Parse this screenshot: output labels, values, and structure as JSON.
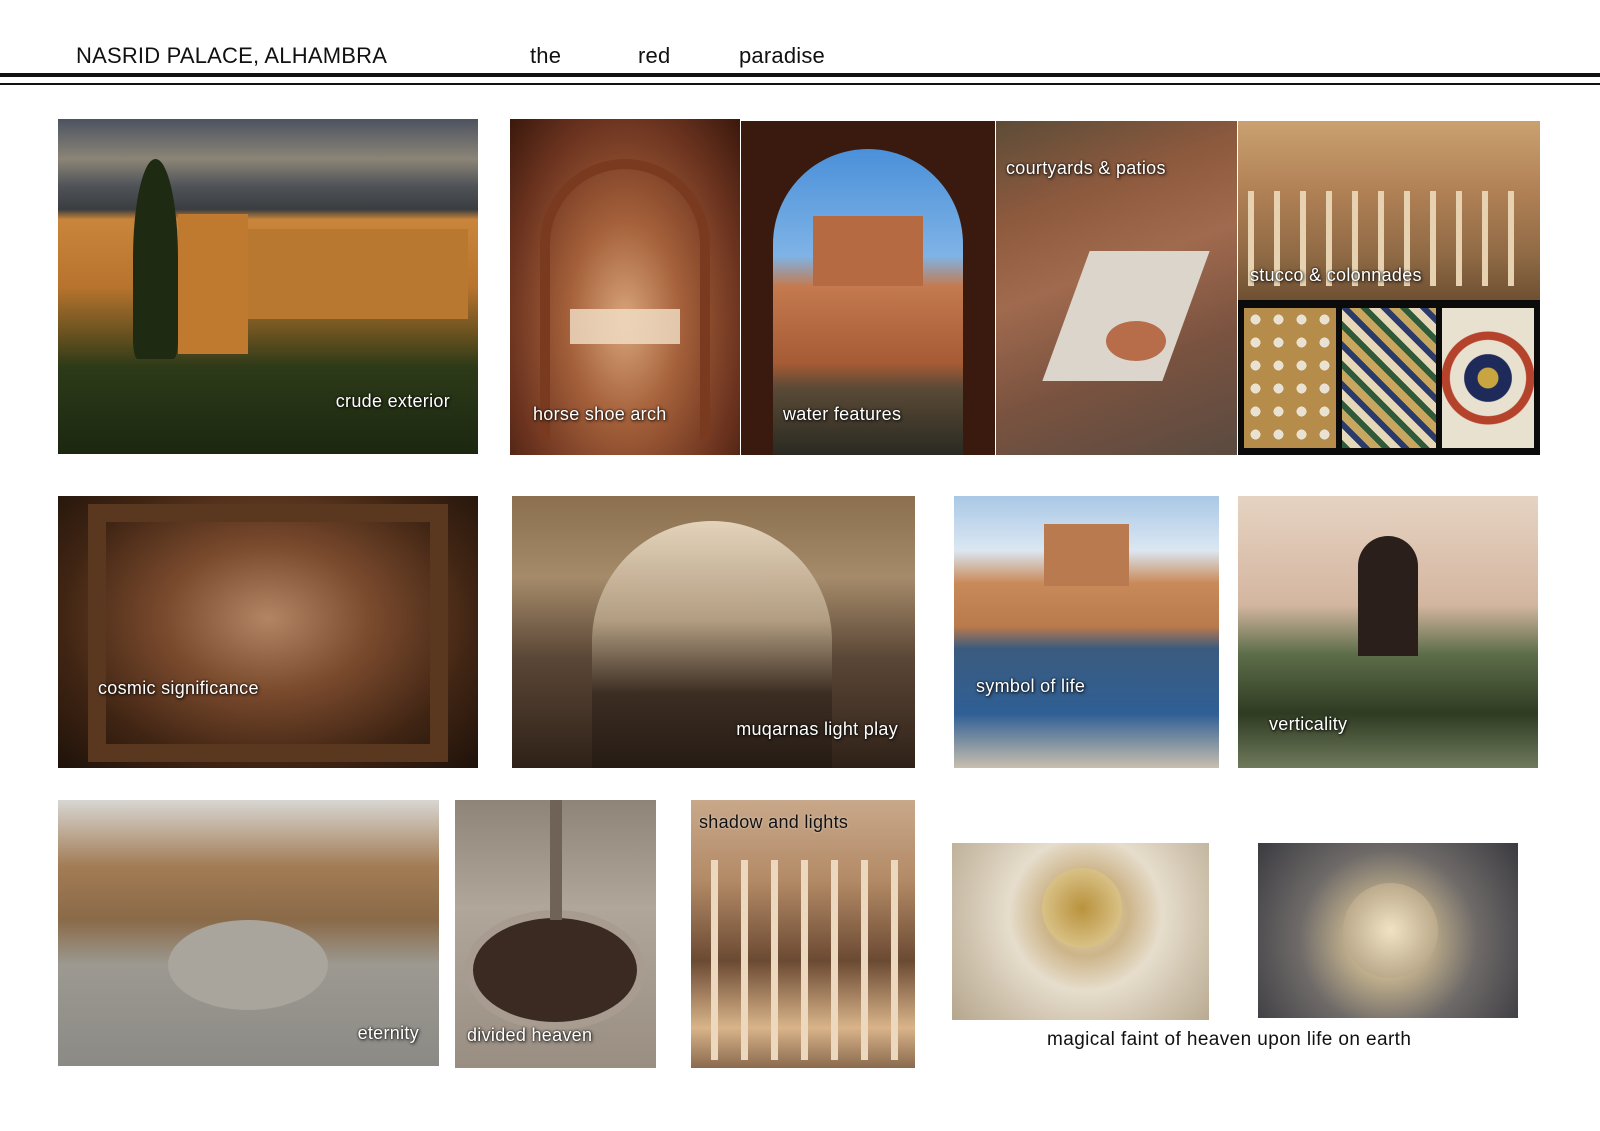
{
  "header": {
    "title": "NASRID PALACE, ALHAMBRA",
    "word1": "the",
    "word2": "red",
    "word3": "paradise"
  },
  "photos": {
    "crude_exterior": "crude exterior",
    "horse_shoe_arch": "horse shoe arch",
    "water_features": "water features",
    "courtyards_patios": "courtyards & patios",
    "stucco_colonnades": "stucco & colonnades",
    "cosmic_significance": "cosmic significance",
    "muqarnas_light_play": "muqarnas light play",
    "symbol_of_life": "symbol of life",
    "verticality": "verticality",
    "eternity": "eternity",
    "divided_heaven": "divided heaven",
    "shadow_and_lights": "shadow and lights"
  },
  "caption": "magical faint of heaven upon life on earth",
  "colors": {
    "text": "#111111",
    "label": "#ffffff",
    "rule": "#111111"
  }
}
